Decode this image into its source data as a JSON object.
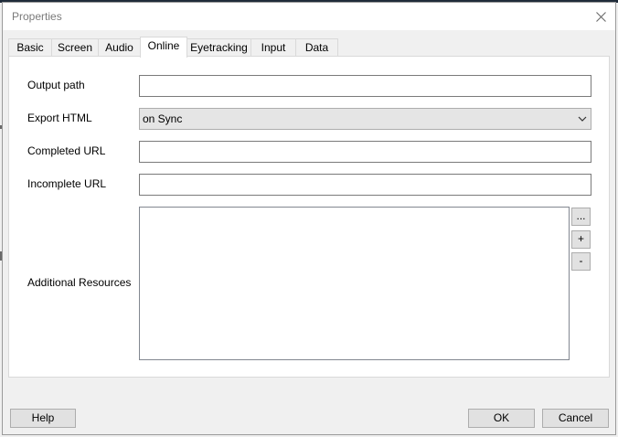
{
  "window": {
    "title": "Properties"
  },
  "tabs": [
    {
      "label": "Basic"
    },
    {
      "label": "Screen"
    },
    {
      "label": "Audio"
    },
    {
      "label": "Online"
    },
    {
      "label": "Eyetracking"
    },
    {
      "label": "Input"
    },
    {
      "label": "Data"
    }
  ],
  "active_tab": "Online",
  "form": {
    "output_path": {
      "label": "Output path",
      "value": ""
    },
    "export_html": {
      "label": "Export HTML",
      "selected": "on Sync"
    },
    "completed_url": {
      "label": "Completed URL",
      "value": ""
    },
    "incomplete_url": {
      "label": "Incomplete URL",
      "value": ""
    },
    "additional_resources": {
      "label": "Additional Resources",
      "buttons": {
        "browse": "...",
        "add": "+",
        "remove": "-"
      }
    }
  },
  "footer": {
    "help": "Help",
    "ok": "OK",
    "cancel": "Cancel"
  },
  "icons": {
    "close": "close-icon",
    "dropdown": "chevron-down-icon"
  },
  "colors": {
    "active_tab_bg": "#ffffff",
    "dialog_bg": "#f0f0f0",
    "button_bg": "#e1e1e1"
  }
}
